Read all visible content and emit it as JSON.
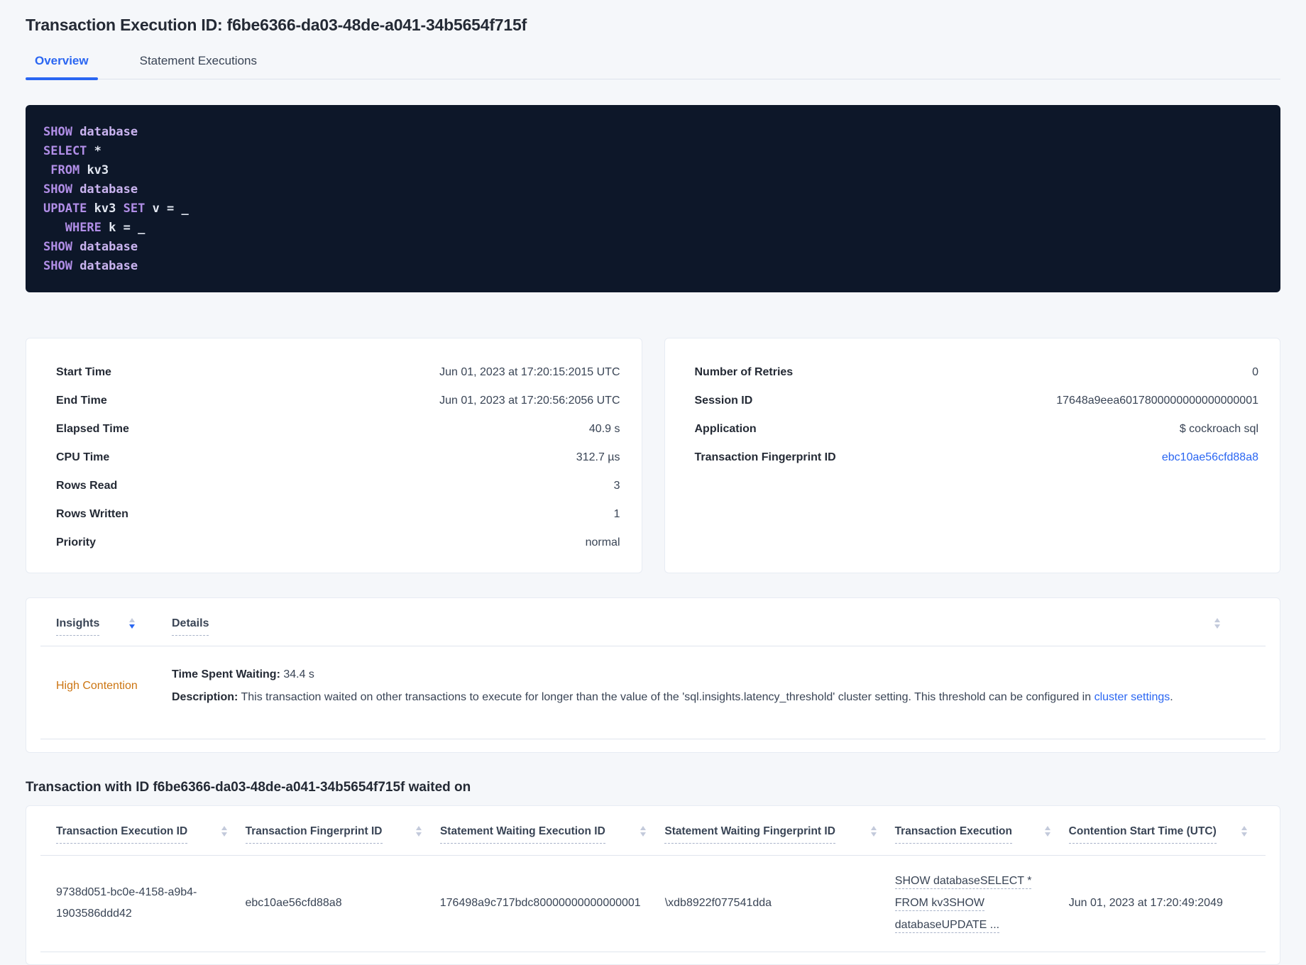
{
  "title": "Transaction Execution ID: f6be6366-da03-48de-a041-34b5654f715f",
  "tabs": {
    "overview": "Overview",
    "statement_executions": "Statement Executions"
  },
  "sql": {
    "lines": [
      [
        [
          "kw",
          "SHOW"
        ],
        [
          "kw2",
          " database"
        ]
      ],
      [
        [
          "kw",
          "SELECT"
        ],
        [
          "pl",
          " *"
        ]
      ],
      [
        [
          "pl",
          " "
        ],
        [
          "kw",
          "FROM"
        ],
        [
          "pl",
          " kv3"
        ]
      ],
      [
        [
          "kw",
          "SHOW"
        ],
        [
          "kw2",
          " database"
        ]
      ],
      [
        [
          "kw",
          "UPDATE"
        ],
        [
          "pl",
          " kv3 "
        ],
        [
          "kw",
          "SET"
        ],
        [
          "pl",
          " v = _"
        ]
      ],
      [
        [
          "pl",
          "   "
        ],
        [
          "kw",
          "WHERE"
        ],
        [
          "pl",
          " k = _"
        ]
      ],
      [
        [
          "kw",
          "SHOW"
        ],
        [
          "kw2",
          " database"
        ]
      ],
      [
        [
          "kw",
          "SHOW"
        ],
        [
          "kw2",
          " database"
        ]
      ]
    ]
  },
  "summary_left": {
    "rows": [
      {
        "label": "Start Time",
        "value": "Jun 01, 2023 at 17:20:15:2015 UTC"
      },
      {
        "label": "End Time",
        "value": "Jun 01, 2023 at 17:20:56:2056 UTC"
      },
      {
        "label": "Elapsed Time",
        "value": "40.9 s"
      },
      {
        "label": "CPU Time",
        "value": "312.7 µs"
      },
      {
        "label": "Rows Read",
        "value": "3"
      },
      {
        "label": "Rows Written",
        "value": "1"
      },
      {
        "label": "Priority",
        "value": "normal"
      }
    ]
  },
  "summary_right": {
    "rows": [
      {
        "label": "Number of Retries",
        "value": "0"
      },
      {
        "label": "Session ID",
        "value": "17648a9eea6017800000000000000001"
      },
      {
        "label": "Application",
        "value": "$ cockroach sql"
      },
      {
        "label": "Transaction Fingerprint ID",
        "value": "ebc10ae56cfd88a8",
        "link": true
      }
    ]
  },
  "insights": {
    "columns": {
      "insights": "Insights",
      "details": "Details"
    },
    "sort_state": "desc",
    "row": {
      "insight": "High Contention",
      "waiting_label": "Time Spent Waiting:",
      "waiting_value": " 34.4 s",
      "description_label": "Description:",
      "description_text": " This transaction waited on other transactions to execute for longer than the value of the 'sql.insights.latency_threshold' cluster setting. This threshold can be configured in ",
      "description_link": "cluster settings",
      "description_suffix": "."
    }
  },
  "waited_on": {
    "heading": "Transaction with ID f6be6366-da03-48de-a041-34b5654f715f waited on",
    "columns": [
      "Transaction Execution ID",
      "Transaction Fingerprint ID",
      "Statement Waiting Execution ID",
      "Statement Waiting Fingerprint ID",
      "Transaction Execution",
      "Contention Start Time (UTC)"
    ],
    "row": {
      "transaction_execution_id": "9738d051-bc0e-4158-a9b4-1903586ddd42",
      "transaction_fingerprint_id": "ebc10ae56cfd88a8",
      "statement_waiting_execution_id": "176498a9c717bdc80000000000000001",
      "statement_waiting_fingerprint_id": "\\xdb8922f077541dda",
      "transaction_execution_lines": [
        "SHOW databaseSELECT *",
        "FROM kv3SHOW",
        "databaseUPDATE ..."
      ],
      "contention_start_time": "Jun 01, 2023 at 17:20:49:2049"
    }
  },
  "colors": {
    "accent_blue": "#2a66f2",
    "warning_orange": "#cc7512",
    "code_background": "#0d1729",
    "code_keyword": "#b18ee7",
    "code_keyword_secondary": "#cab4f0",
    "code_plain": "#e3e8f2",
    "page_background": "#f5f7fa"
  }
}
